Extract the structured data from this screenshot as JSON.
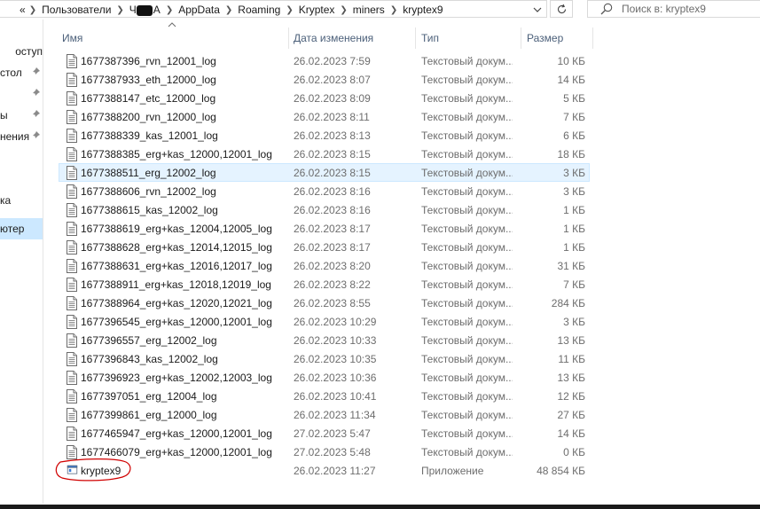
{
  "address": {
    "back_chevron": "«",
    "segments": [
      "Пользователи",
      "Ч",
      "А",
      "AppData",
      "Roaming",
      "Kryptex",
      "miners",
      "kryptex9"
    ]
  },
  "search": {
    "placeholder": "Поиск в: kryptex9"
  },
  "nav": [
    {
      "label": "оступ",
      "pinned": false
    },
    {
      "label": "стол",
      "pinned": true
    },
    {
      "label": "",
      "pinned": true
    },
    {
      "label": "ы",
      "pinned": true
    },
    {
      "label": "нения",
      "pinned": true
    },
    {
      "label": "ка",
      "pinned": false
    },
    {
      "label": "ютер",
      "pinned": false,
      "selected": true
    }
  ],
  "columns": {
    "name": "Имя",
    "date": "Дата изменения",
    "type": "Тип",
    "size": "Размер"
  },
  "files": [
    {
      "name": "1677387396_rvn_12001_log",
      "date": "26.02.2023 7:59",
      "type": "Текстовый докум...",
      "size": "10 КБ"
    },
    {
      "name": "1677387933_eth_12000_log",
      "date": "26.02.2023 8:07",
      "type": "Текстовый докум...",
      "size": "14 КБ"
    },
    {
      "name": "1677388147_etc_12000_log",
      "date": "26.02.2023 8:09",
      "type": "Текстовый докум...",
      "size": "5 КБ"
    },
    {
      "name": "1677388200_rvn_12000_log",
      "date": "26.02.2023 8:11",
      "type": "Текстовый докум...",
      "size": "7 КБ"
    },
    {
      "name": "1677388339_kas_12001_log",
      "date": "26.02.2023 8:13",
      "type": "Текстовый докум...",
      "size": "6 КБ"
    },
    {
      "name": "1677388385_erg+kas_12000,12001_log",
      "date": "26.02.2023 8:15",
      "type": "Текстовый докум...",
      "size": "18 КБ"
    },
    {
      "name": "1677388511_erg_12002_log",
      "date": "26.02.2023 8:15",
      "type": "Текстовый докум...",
      "size": "3 КБ",
      "selected": true
    },
    {
      "name": "1677388606_rvn_12002_log",
      "date": "26.02.2023 8:16",
      "type": "Текстовый докум...",
      "size": "3 КБ"
    },
    {
      "name": "1677388615_kas_12002_log",
      "date": "26.02.2023 8:16",
      "type": "Текстовый докум...",
      "size": "1 КБ"
    },
    {
      "name": "1677388619_erg+kas_12004,12005_log",
      "date": "26.02.2023 8:17",
      "type": "Текстовый докум...",
      "size": "1 КБ"
    },
    {
      "name": "1677388628_erg+kas_12014,12015_log",
      "date": "26.02.2023 8:17",
      "type": "Текстовый докум...",
      "size": "1 КБ"
    },
    {
      "name": "1677388631_erg+kas_12016,12017_log",
      "date": "26.02.2023 8:20",
      "type": "Текстовый докум...",
      "size": "31 КБ"
    },
    {
      "name": "1677388911_erg+kas_12018,12019_log",
      "date": "26.02.2023 8:22",
      "type": "Текстовый докум...",
      "size": "7 КБ"
    },
    {
      "name": "1677388964_erg+kas_12020,12021_log",
      "date": "26.02.2023 8:55",
      "type": "Текстовый докум...",
      "size": "284 КБ"
    },
    {
      "name": "1677396545_erg+kas_12000,12001_log",
      "date": "26.02.2023 10:29",
      "type": "Текстовый докум...",
      "size": "3 КБ"
    },
    {
      "name": "1677396557_erg_12002_log",
      "date": "26.02.2023 10:33",
      "type": "Текстовый докум...",
      "size": "13 КБ"
    },
    {
      "name": "1677396843_kas_12002_log",
      "date": "26.02.2023 10:35",
      "type": "Текстовый докум...",
      "size": "11 КБ"
    },
    {
      "name": "1677396923_erg+kas_12002,12003_log",
      "date": "26.02.2023 10:36",
      "type": "Текстовый докум...",
      "size": "13 КБ"
    },
    {
      "name": "1677397051_erg_12004_log",
      "date": "26.02.2023 10:41",
      "type": "Текстовый докум...",
      "size": "12 КБ"
    },
    {
      "name": "1677399861_erg_12000_log",
      "date": "26.02.2023 11:34",
      "type": "Текстовый докум...",
      "size": "27 КБ"
    },
    {
      "name": "1677465947_erg+kas_12000,12001_log",
      "date": "27.02.2023 5:47",
      "type": "Текстовый докум...",
      "size": "14 КБ"
    },
    {
      "name": "1677466079_erg+kas_12000,12001_log",
      "date": "27.02.2023 5:48",
      "type": "Текстовый докум...",
      "size": "0 КБ"
    },
    {
      "name": "kryptex9",
      "date": "26.02.2023 11:27",
      "type": "Приложение",
      "size": "48 854 КБ",
      "app": true
    }
  ],
  "colors": {
    "selection": "#cce8ff",
    "hover": "#e5f3ff",
    "annotation": "#d00000",
    "header_text": "#4c607a"
  }
}
